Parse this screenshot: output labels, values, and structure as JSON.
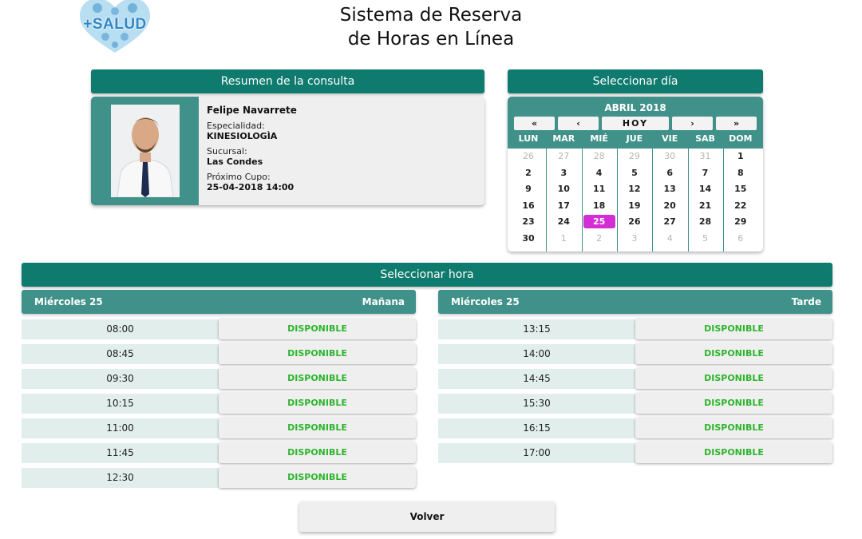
{
  "logo": {
    "text": "+SALUD",
    "icon": "heart-logo-icon"
  },
  "title": {
    "line1": "Sistema de Reserva",
    "line2": "de Horas en Línea"
  },
  "summary": {
    "header": "Resumen de la consulta",
    "name": "Felipe Navarrete",
    "specialty_label": "Especialidad:",
    "specialty": "KINESIOLOGÌA",
    "branch_label": "Sucursal:",
    "branch": "Las Condes",
    "next_label": "Próximo Cupo:",
    "next": "25-04-2018 14:00"
  },
  "calendar": {
    "header": "Seleccionar día",
    "month": "ABRIL 2018",
    "nav": {
      "first": "«",
      "prev": "‹",
      "today": "HOY",
      "next": "›",
      "last": "»"
    },
    "dow": [
      "LUN",
      "MAR",
      "MIÉ",
      "JUE",
      "VIE",
      "SAB",
      "DOM"
    ],
    "weeks": [
      [
        "26",
        "27",
        "28",
        "29",
        "30",
        "31",
        "1"
      ],
      [
        "2",
        "3",
        "4",
        "5",
        "6",
        "7",
        "8"
      ],
      [
        "9",
        "10",
        "11",
        "12",
        "13",
        "14",
        "15"
      ],
      [
        "16",
        "17",
        "18",
        "19",
        "20",
        "21",
        "22"
      ],
      [
        "23",
        "24",
        "25",
        "26",
        "27",
        "28",
        "29"
      ],
      [
        "30",
        "1",
        "2",
        "3",
        "4",
        "5",
        "6"
      ]
    ],
    "selected_day": "25",
    "selected_color": "#d32ed3"
  },
  "hours": {
    "header": "Seleccionar hora",
    "morning": {
      "day": "Miércoles 25",
      "period": "Mañana",
      "slots": [
        {
          "time": "08:00",
          "status": "DISPONIBLE"
        },
        {
          "time": "08:45",
          "status": "DISPONIBLE"
        },
        {
          "time": "09:30",
          "status": "DISPONIBLE"
        },
        {
          "time": "10:15",
          "status": "DISPONIBLE"
        },
        {
          "time": "11:00",
          "status": "DISPONIBLE"
        },
        {
          "time": "11:45",
          "status": "DISPONIBLE"
        },
        {
          "time": "12:30",
          "status": "DISPONIBLE"
        }
      ]
    },
    "afternoon": {
      "day": "Miércoles 25",
      "period": "Tarde",
      "slots": [
        {
          "time": "13:15",
          "status": "DISPONIBLE"
        },
        {
          "time": "14:00",
          "status": "DISPONIBLE"
        },
        {
          "time": "14:45",
          "status": "DISPONIBLE"
        },
        {
          "time": "15:30",
          "status": "DISPONIBLE"
        },
        {
          "time": "16:15",
          "status": "DISPONIBLE"
        },
        {
          "time": "17:00",
          "status": "DISPONIBLE"
        }
      ]
    }
  },
  "back_button": "Volver",
  "colors": {
    "primary": "#0f7a6e",
    "secondary": "#409189",
    "available": "#2db52d",
    "slot_bg": "#e1eeec"
  }
}
